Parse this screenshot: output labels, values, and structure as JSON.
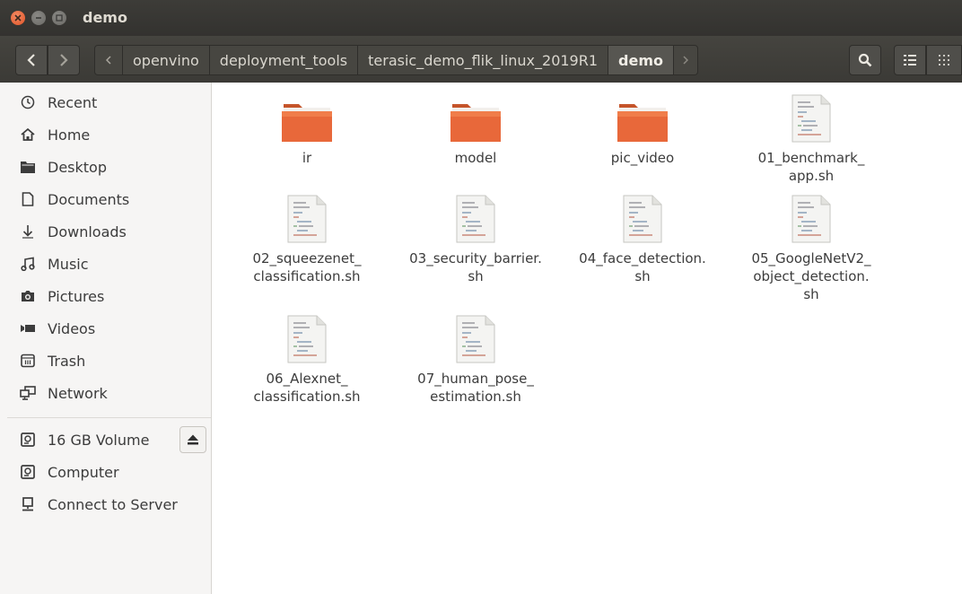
{
  "window": {
    "title": "demo"
  },
  "breadcrumbs": [
    "openvino",
    "deployment_tools",
    "terasic_demo_flik_linux_2019R1",
    "demo"
  ],
  "sidebar": {
    "places": [
      {
        "label": "Recent",
        "icon": "clock-icon"
      },
      {
        "label": "Home",
        "icon": "home-icon"
      },
      {
        "label": "Desktop",
        "icon": "desktop-folder-icon"
      },
      {
        "label": "Documents",
        "icon": "document-icon"
      },
      {
        "label": "Downloads",
        "icon": "download-icon"
      },
      {
        "label": "Music",
        "icon": "music-icon"
      },
      {
        "label": "Pictures",
        "icon": "camera-icon"
      },
      {
        "label": "Videos",
        "icon": "video-icon"
      },
      {
        "label": "Trash",
        "icon": "trash-icon"
      },
      {
        "label": "Network",
        "icon": "network-icon"
      }
    ],
    "devices": [
      {
        "label": "16 GB Volume",
        "icon": "drive-icon"
      },
      {
        "label": "Computer",
        "icon": "drive-icon"
      },
      {
        "label": "Connect to Server",
        "icon": "server-icon"
      }
    ]
  },
  "files": [
    {
      "name": "ir",
      "type": "folder"
    },
    {
      "name": "model",
      "type": "folder"
    },
    {
      "name": "pic_video",
      "type": "folder"
    },
    {
      "name": "01_benchmark_\napp.sh",
      "type": "script"
    },
    {
      "name": "02_squeezenet_\nclassification.sh",
      "type": "script"
    },
    {
      "name": "03_security_barrier.\nsh",
      "type": "script"
    },
    {
      "name": "04_face_detection.\nsh",
      "type": "script"
    },
    {
      "name": "05_GoogleNetV2_\nobject_detection.\nsh",
      "type": "script"
    },
    {
      "name": "06_Alexnet_\nclassification.sh",
      "type": "script"
    },
    {
      "name": "07_human_pose_\nestimation.sh",
      "type": "script"
    }
  ],
  "colors": {
    "folder": "#e8683a",
    "titlebar": "#3c3b37",
    "close": "#e05427"
  }
}
